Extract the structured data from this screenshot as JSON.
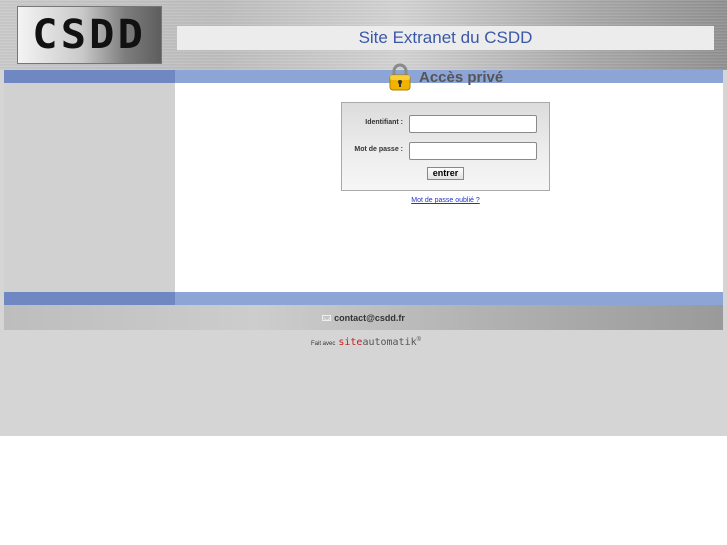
{
  "header": {
    "logo_text": "CSDD"
  },
  "main": {
    "title": "Site Extranet du CSDD",
    "access_label": "Accès privé",
    "login": {
      "username_label": "Identifiant :",
      "username_value": "",
      "password_label": "Mot de passe :",
      "password_value": "",
      "submit_label": "entrer"
    },
    "forgot_password": "Mot de passe oublié ?"
  },
  "footer": {
    "contact_email": "contact@csdd.fr",
    "credits_prefix": "Fait avec",
    "credits_brand_part1": "site",
    "credits_brand_part2": "automatik",
    "credits_mark": "®"
  },
  "colors": {
    "accent_bar": "#8da5d6",
    "title_blue": "#3a58a8",
    "link_blue": "#2233cc",
    "brand_red": "#c02020"
  },
  "icons": {
    "lock": "padlock-icon",
    "mail": "envelope-icon"
  }
}
